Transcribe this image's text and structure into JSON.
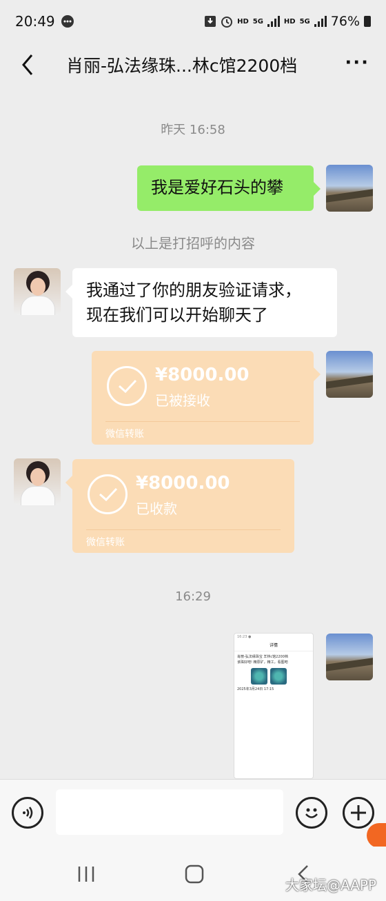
{
  "status_bar": {
    "time": "20:49",
    "battery": "76%",
    "hd1": "HD",
    "g1": "5G",
    "hd2": "HD",
    "g2": "5G"
  },
  "header": {
    "title": "肖丽-弘法缘珠...林c馆2200档",
    "more": "···"
  },
  "messages": {
    "ts1": "昨天 16:58",
    "greeting": "我是爱好石头的攀",
    "sys_note": "以上是打招呼的内容",
    "verify_line1": "我通过了你的朋友验证请求，",
    "verify_line2": "现在我们可以开始聊天了",
    "transfer1": {
      "amount": "¥8000.00",
      "status": "已被接收",
      "footer": "微信转账"
    },
    "transfer2": {
      "amount": "¥8000.00",
      "status": "已收款",
      "footer": "微信转账"
    },
    "ts2": "16:29"
  },
  "image_preview": {
    "top": "16:23 ●",
    "head": "详情",
    "line1": "肖丽-弘法缘珠宝  羊林c馆2200档",
    "line2": "该珠好吧! 精原矿，精工，看图吧",
    "date": "2025年3月24日 17:15"
  },
  "watermark": "大家坛@AAPP"
}
